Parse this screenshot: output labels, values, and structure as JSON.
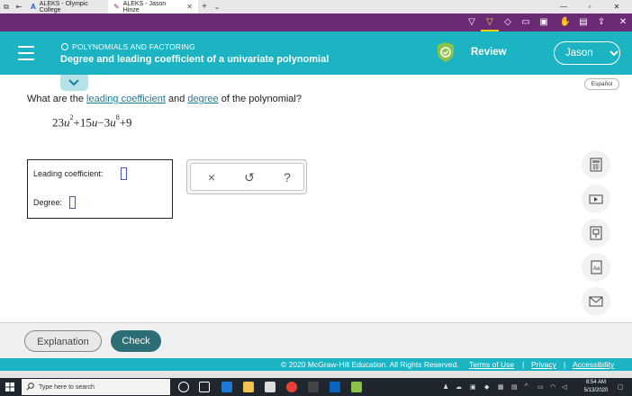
{
  "browser": {
    "tabs": [
      {
        "label": "ALEKS - Olympic College",
        "active": false
      },
      {
        "label": "ALEKS - Jason Hinze",
        "active": true
      }
    ]
  },
  "header": {
    "topic": "POLYNOMIALS AND FACTORING",
    "title": "Degree and leading coefficient of a univariate polynomial",
    "review_label": "Review",
    "user_name": "Jason"
  },
  "language_label": "Español",
  "question": {
    "prefix": "What are the ",
    "link1": "leading coefficient",
    "middle": " and ",
    "link2": "degree",
    "suffix": " of the polynomial?"
  },
  "polynomial": {
    "c1": "23",
    "v1": "u",
    "e1": "2",
    "op1": "+",
    "c2": "15",
    "v2": "u",
    "op2": "−",
    "c3": "3",
    "v3": "u",
    "e3": "8",
    "op3": "+",
    "c4": "9"
  },
  "answer": {
    "leading_label": "Leading coefficient:",
    "degree_label": "Degree:"
  },
  "tools": {
    "clear": "×",
    "undo": "↺",
    "help": "?"
  },
  "footer": {
    "explanation_label": "Explanation",
    "check_label": "Check",
    "copyright": "© 2020 McGraw-Hill Education. All Rights Reserved.",
    "terms": "Terms of Use",
    "privacy": "Privacy",
    "accessibility": "Accessibility"
  },
  "taskbar": {
    "search_placeholder": "Type here to search",
    "time": "8:54 AM",
    "date": "5/13/2020"
  },
  "colors": {
    "teal": "#1cb3c3",
    "purple": "#6a2a74",
    "check": "#2c6e75",
    "link": "#1a7f9f"
  }
}
